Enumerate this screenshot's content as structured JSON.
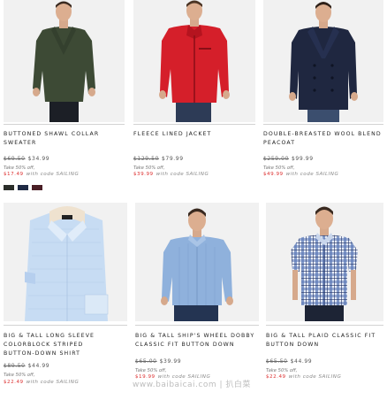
{
  "products": [
    {
      "title_line1": "BUTTONED SHAWL COLLAR",
      "title_line2": "SWEATER",
      "original_price": "$69.50",
      "price": "$34.99",
      "promo_text": "Take 50% off,",
      "sale_price": "$17.49",
      "code_text": "with code SAILING",
      "swatches": [
        "#2b2e2a",
        "#1f2a44",
        "#4a1f26"
      ]
    },
    {
      "title_line1": "FLEECE LINED JACKET",
      "title_line2": "",
      "original_price": "$129.50",
      "price": "$79.99",
      "promo_text": "Take 50% off,",
      "sale_price": "$39.99",
      "code_text": "with code SAILING"
    },
    {
      "title_line1": "DOUBLE-BREASTED WOOL BLEND",
      "title_line2": "PEACOAT",
      "original_price": "$259.00",
      "price": "$99.99",
      "promo_text": "Take 50% off,",
      "sale_price": "$49.99",
      "code_text": "with code SAILING"
    },
    {
      "title_line1": "BIG & TALL LONG SLEEVE",
      "title_line2": "COLORBLOCK STRIPED",
      "title_line3": "BUTTON-DOWN SHIRT",
      "original_price": "$89.50",
      "price": "$44.99",
      "promo_text": "Take 50% off,",
      "sale_price": "$22.49",
      "code_text": "with code SAILING"
    },
    {
      "title_line1": "BIG & TALL SHIP'S WHEEL DOBBY",
      "title_line2": "CLASSIC FIT BUTTON DOWN",
      "original_price": "$65.00",
      "price": "$39.99",
      "promo_text": "Take 50% off,",
      "sale_price": "$19.99",
      "code_text": "with code SAILING"
    },
    {
      "title_line1": "BIG & TALL PLAID CLASSIC FIT",
      "title_line2": "BUTTON DOWN",
      "original_price": "$65.50",
      "price": "$44.99",
      "promo_text": "Take 50% off,",
      "sale_price": "$22.49",
      "code_text": "with code SAILING"
    }
  ],
  "watermark": "www.baibaicai.com | 扒白菜"
}
